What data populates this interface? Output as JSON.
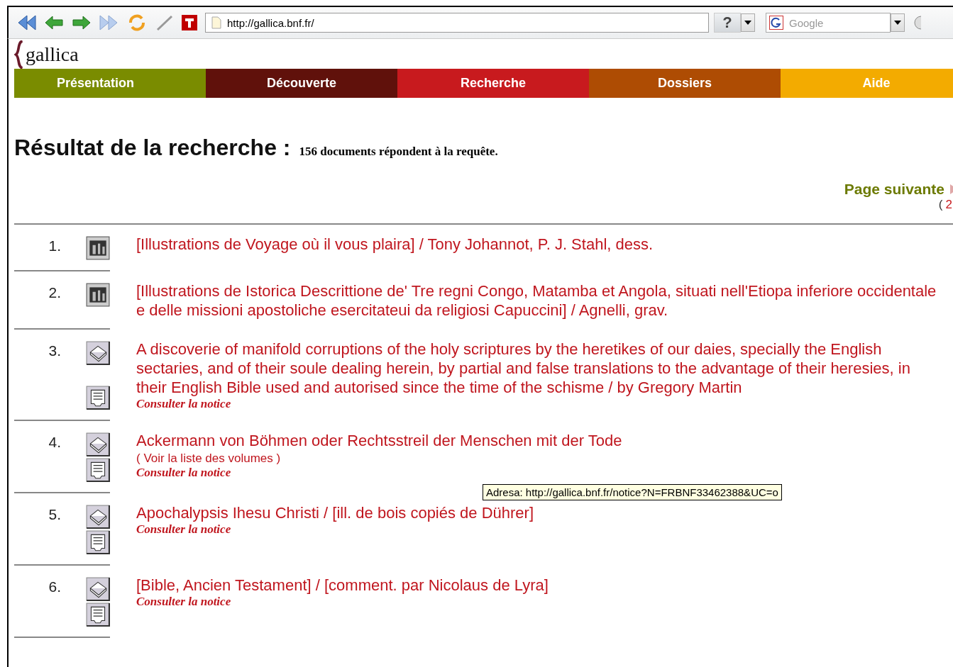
{
  "toolbar": {
    "url": "http://gallica.bnf.fr/",
    "help": "?",
    "search": {
      "placeholder": "Google"
    }
  },
  "logo": {
    "text": "gallica"
  },
  "nav": [
    {
      "label": "Présentation",
      "color": "#7a8c00"
    },
    {
      "label": "Découverte",
      "color": "#60110b"
    },
    {
      "label": "Recherche",
      "color": "#c81a1e"
    },
    {
      "label": "Dossiers",
      "color": "#ae4c03"
    },
    {
      "label": "Aide",
      "color": "#f3ab00"
    }
  ],
  "heading": {
    "title": "Résultat de la recherche :",
    "count": "156 documents répondent à la requête."
  },
  "pager": {
    "next": "Page suivante",
    "open": "(",
    "pages": [
      "2"
    ]
  },
  "results": [
    {
      "number": "1.",
      "icons": [
        {
          "kind": "image"
        }
      ],
      "title": "[Illustrations de Voyage où il vous plaira] / Tony Johannot, P. J. Stahl, dess."
    },
    {
      "number": "2.",
      "icons": [
        {
          "kind": "image"
        }
      ],
      "title": "[Illustrations de Istorica Descrittione de' Tre regni Congo, Matamba et Angola, situati nell'Etiopa inferiore occidentale e delle missioni apostoliche esercitateui da religiosi Capuccini] / Agnelli, grav."
    },
    {
      "number": "3.",
      "icons": [
        {
          "kind": "book"
        },
        {
          "kind": "notice"
        }
      ],
      "title": "A discoverie of manifold corruptions of the holy scriptures by the heretikes of our daies, specially the English sectaries, and of their soule dealing herein, by partial and false translations to the advantage of their heresies, in their English Bible used and autorised since the time of the schisme / by Gregory Martin",
      "notice": "Consulter la notice"
    },
    {
      "number": "4.",
      "icons": [
        {
          "kind": "book"
        },
        {
          "kind": "notice"
        }
      ],
      "title": "Ackermann von Böhmen oder Rechtsstreil der Menschen mit der Tode",
      "volumes": "( Voir la liste des volumes )",
      "notice": "Consulter la notice"
    },
    {
      "number": "5.",
      "icons": [
        {
          "kind": "book"
        },
        {
          "kind": "notice"
        }
      ],
      "title": "Apochalypsis Ihesu Christi / [ill. de bois copiés de Dührer]",
      "notice": "Consulter la notice"
    },
    {
      "number": "6.",
      "icons": [
        {
          "kind": "book"
        },
        {
          "kind": "notice"
        }
      ],
      "title": "[Bible, Ancien Testament] / [comment. par Nicolaus de Lyra]",
      "notice": "Consulter la notice"
    }
  ],
  "tooltip": "Adresa: http://gallica.bnf.fr/notice?N=FRBNF33462388&UC=o"
}
